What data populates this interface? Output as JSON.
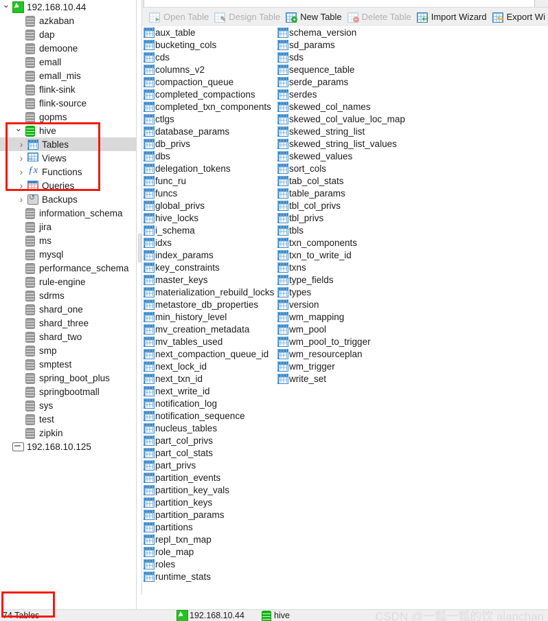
{
  "window": {
    "tab_bar_visible": true
  },
  "toolbar": {
    "items": [
      {
        "label": "Open Table",
        "icon": "open-table-icon",
        "enabled": false
      },
      {
        "label": "Design Table",
        "icon": "design-table-icon",
        "enabled": false
      },
      {
        "label": "New Table",
        "icon": "new-table-icon",
        "enabled": true
      },
      {
        "label": "Delete Table",
        "icon": "delete-table-icon",
        "enabled": false
      },
      {
        "label": "Import Wizard",
        "icon": "import-wizard-icon",
        "enabled": true
      },
      {
        "label": "Export Wi",
        "icon": "export-wizard-icon",
        "enabled": true
      }
    ]
  },
  "sidebar": {
    "connections": [
      {
        "label": "192.168.10.44",
        "icon": "connection-icon",
        "expanded": true,
        "databases": [
          {
            "label": "azkaban",
            "icon": "database-icon"
          },
          {
            "label": "dap",
            "icon": "database-icon"
          },
          {
            "label": "demoone",
            "icon": "database-icon"
          },
          {
            "label": "emall",
            "icon": "database-icon"
          },
          {
            "label": "emall_mis",
            "icon": "database-icon"
          },
          {
            "label": "flink-sink",
            "icon": "database-icon"
          },
          {
            "label": "flink-source",
            "icon": "database-icon"
          },
          {
            "label": "gopms",
            "icon": "database-icon"
          },
          {
            "label": "hive",
            "icon": "database-open-icon",
            "expanded": true,
            "active": true,
            "children": [
              {
                "label": "Tables",
                "icon": "tables-icon",
                "selected": true
              },
              {
                "label": "Views",
                "icon": "views-icon",
                "selected": false
              },
              {
                "label": "Functions",
                "icon": "functions-icon",
                "selected": false
              },
              {
                "label": "Queries",
                "icon": "queries-icon",
                "selected": false
              },
              {
                "label": "Backups",
                "icon": "backups-icon",
                "selected": false
              }
            ]
          },
          {
            "label": "information_schema",
            "icon": "database-icon"
          },
          {
            "label": "jira",
            "icon": "database-icon"
          },
          {
            "label": "ms",
            "icon": "database-icon"
          },
          {
            "label": "mysql",
            "icon": "database-icon"
          },
          {
            "label": "performance_schema",
            "icon": "database-icon"
          },
          {
            "label": "rule-engine",
            "icon": "database-icon"
          },
          {
            "label": "sdrms",
            "icon": "database-icon"
          },
          {
            "label": "shard_one",
            "icon": "database-icon"
          },
          {
            "label": "shard_three",
            "icon": "database-icon"
          },
          {
            "label": "shard_two",
            "icon": "database-icon"
          },
          {
            "label": "smp",
            "icon": "database-icon"
          },
          {
            "label": "smptest",
            "icon": "database-icon"
          },
          {
            "label": "spring_boot_plus",
            "icon": "database-icon"
          },
          {
            "label": "springbootmall",
            "icon": "database-icon"
          },
          {
            "label": "sys",
            "icon": "database-icon"
          },
          {
            "label": "test",
            "icon": "database-icon"
          },
          {
            "label": "zipkin",
            "icon": "database-icon"
          }
        ]
      },
      {
        "label": "192.168.10.125",
        "icon": "monitor-icon",
        "expanded": false,
        "databases": []
      }
    ]
  },
  "objects": {
    "icon": "table-icon",
    "column1": [
      "aux_table",
      "bucketing_cols",
      "cds",
      "columns_v2",
      "compaction_queue",
      "completed_compactions",
      "completed_txn_components",
      "ctlgs",
      "database_params",
      "db_privs",
      "dbs",
      "delegation_tokens",
      "func_ru",
      "funcs",
      "global_privs",
      "hive_locks",
      "i_schema",
      "idxs",
      "index_params",
      "key_constraints",
      "master_keys",
      "materialization_rebuild_locks",
      "metastore_db_properties",
      "min_history_level",
      "mv_creation_metadata",
      "mv_tables_used",
      "next_compaction_queue_id",
      "next_lock_id",
      "next_txn_id",
      "next_write_id",
      "notification_log",
      "notification_sequence",
      "nucleus_tables",
      "part_col_privs",
      "part_col_stats",
      "part_privs",
      "partition_events",
      "partition_key_vals",
      "partition_keys",
      "partition_params",
      "partitions",
      "repl_txn_map",
      "role_map",
      "roles",
      "runtime_stats"
    ],
    "column2": [
      "schema_version",
      "sd_params",
      "sds",
      "sequence_table",
      "serde_params",
      "serdes",
      "skewed_col_names",
      "skewed_col_value_loc_map",
      "skewed_string_list",
      "skewed_string_list_values",
      "skewed_values",
      "sort_cols",
      "tab_col_stats",
      "table_params",
      "tbl_col_privs",
      "tbl_privs",
      "tbls",
      "txn_components",
      "txn_to_write_id",
      "txns",
      "type_fields",
      "types",
      "version",
      "wm_mapping",
      "wm_pool",
      "wm_pool_to_trigger",
      "wm_resourceplan",
      "wm_trigger",
      "write_set"
    ]
  },
  "statusbar": {
    "count_label": "74 Tables",
    "host": "192.168.10.44",
    "host_icon": "connection-icon",
    "database": "hive",
    "database_icon": "database-open-icon"
  },
  "watermark": "CSDN @一瓢一瓢的饮 alanchan",
  "colors": {
    "highlight_box": "#f31b0c",
    "selection": "#d9d9d9",
    "accent_blue": "#3f86c4",
    "accent_green": "#22c522",
    "toolbar_bg": "#efefef",
    "disabled_text": "#b0b0b0"
  }
}
